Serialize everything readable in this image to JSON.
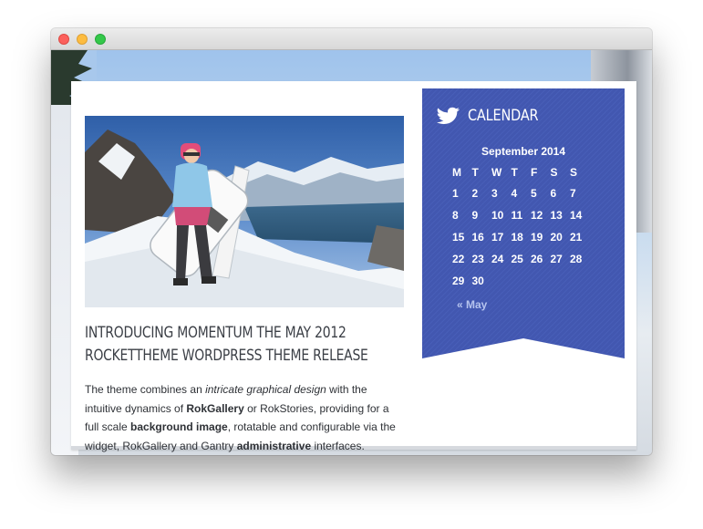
{
  "window": {
    "controls": [
      "close",
      "minimize",
      "zoom"
    ]
  },
  "post": {
    "title": "INTRODUCING MOMENTUM THE MAY 2012 ROCKETTHEME WORDPRESS THEME RELEASE",
    "body": {
      "t1": "The theme combines an ",
      "i1": "intricate graphical design",
      "t2": " with the intuitive dynamics of ",
      "b1": "RokGallery",
      "t3": " or RokStories, providing for a full scale ",
      "b2": "background image",
      "t4": ", rotatable and configurable via the widget, RokGallery and Gantry ",
      "b3": "administrative",
      "t5": " interfaces."
    }
  },
  "calendar": {
    "title": "CALENDAR",
    "month": "September 2014",
    "weekdays": [
      "M",
      "T",
      "W",
      "T",
      "F",
      "S",
      "S"
    ],
    "weeks": [
      [
        "1",
        "2",
        "3",
        "4",
        "5",
        "6",
        "7"
      ],
      [
        "8",
        "9",
        "10",
        "11",
        "12",
        "13",
        "14"
      ],
      [
        "15",
        "16",
        "17",
        "18",
        "19",
        "20",
        "21"
      ],
      [
        "22",
        "23",
        "24",
        "25",
        "26",
        "27",
        "28"
      ],
      [
        "29",
        "30",
        "",
        "",
        "",
        "",
        ""
      ]
    ],
    "prev_link": "« May",
    "accent_color": "#4257b0"
  },
  "icons": {
    "widget": "twitter-bird-icon"
  }
}
